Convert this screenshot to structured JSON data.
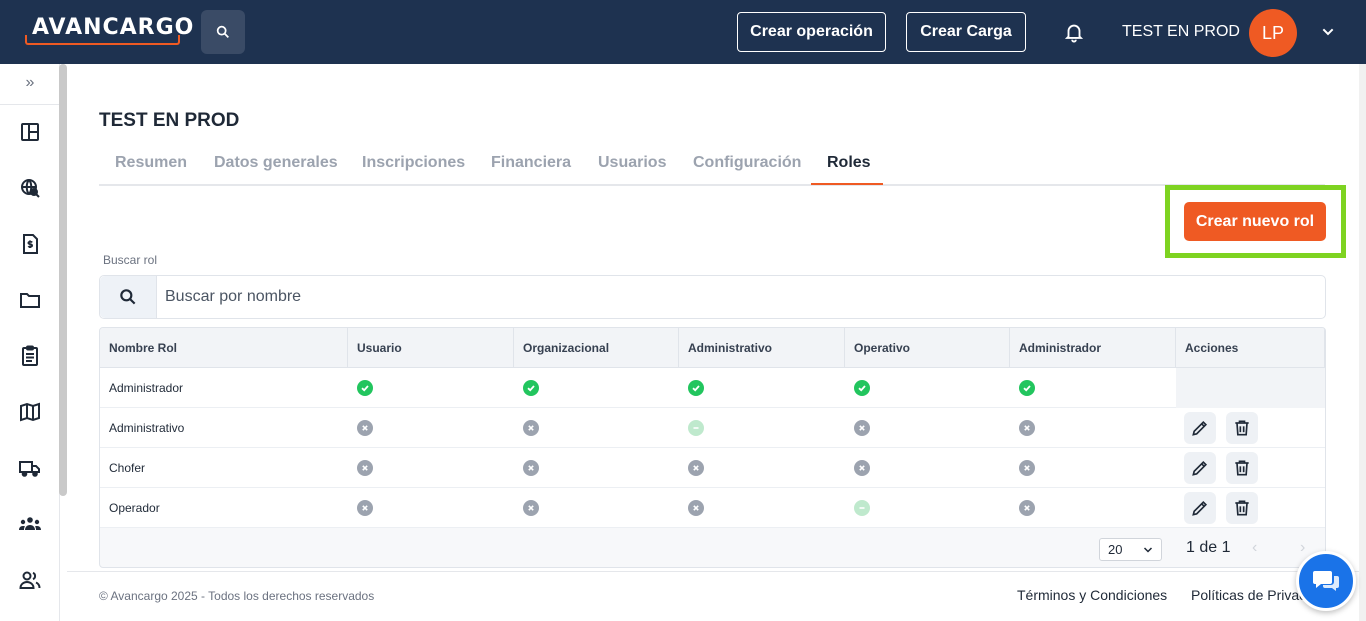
{
  "brand": {
    "logo_text": "AVANCARGO",
    "primary": "#1e3250",
    "accent": "#ef5a23",
    "highlight": "#7ed321"
  },
  "header": {
    "create_operation": "Crear operación",
    "create_load": "Crear Carga",
    "company": "TEST EN PROD",
    "avatar_initials": "LP"
  },
  "sidebar": {
    "items": [
      "dashboard-icon",
      "globe-search-icon",
      "invoice-dollar-icon",
      "folder-icon",
      "clipboard-list-icon",
      "map-icon",
      "truck-icon",
      "team-icon",
      "users-icon"
    ]
  },
  "page": {
    "title": "TEST EN PROD"
  },
  "tabs": [
    {
      "label": "Resumen"
    },
    {
      "label": "Datos generales"
    },
    {
      "label": "Inscripciones"
    },
    {
      "label": "Financiera"
    },
    {
      "label": "Usuarios"
    },
    {
      "label": "Configuración"
    },
    {
      "label": "Roles",
      "active": true
    }
  ],
  "actions": {
    "new_role": "Crear nuevo rol"
  },
  "search": {
    "label": "Buscar rol",
    "placeholder": "Buscar por nombre",
    "value": ""
  },
  "table": {
    "columns": [
      "Nombre Rol",
      "Usuario",
      "Organizacional",
      "Administrativo",
      "Operativo",
      "Administrador",
      "Acciones"
    ],
    "rows": [
      {
        "name": "Administrador",
        "perms": [
          "check",
          "check",
          "check",
          "check",
          "check"
        ],
        "actions": false
      },
      {
        "name": "Administrativo",
        "perms": [
          "x",
          "x",
          "partial",
          "x",
          "x"
        ],
        "actions": true
      },
      {
        "name": "Chofer",
        "perms": [
          "x",
          "x",
          "x",
          "x",
          "x"
        ],
        "actions": true
      },
      {
        "name": "Operador",
        "perms": [
          "x",
          "x",
          "x",
          "partial",
          "x"
        ],
        "actions": true
      }
    ]
  },
  "pagination": {
    "page_size": "20",
    "page_text": "1 de 1"
  },
  "footer": {
    "copyright": "© Avancargo 2025 - Todos los derechos reservados",
    "terms": "Términos y Condiciones",
    "privacy": "Políticas de Privacidad"
  }
}
